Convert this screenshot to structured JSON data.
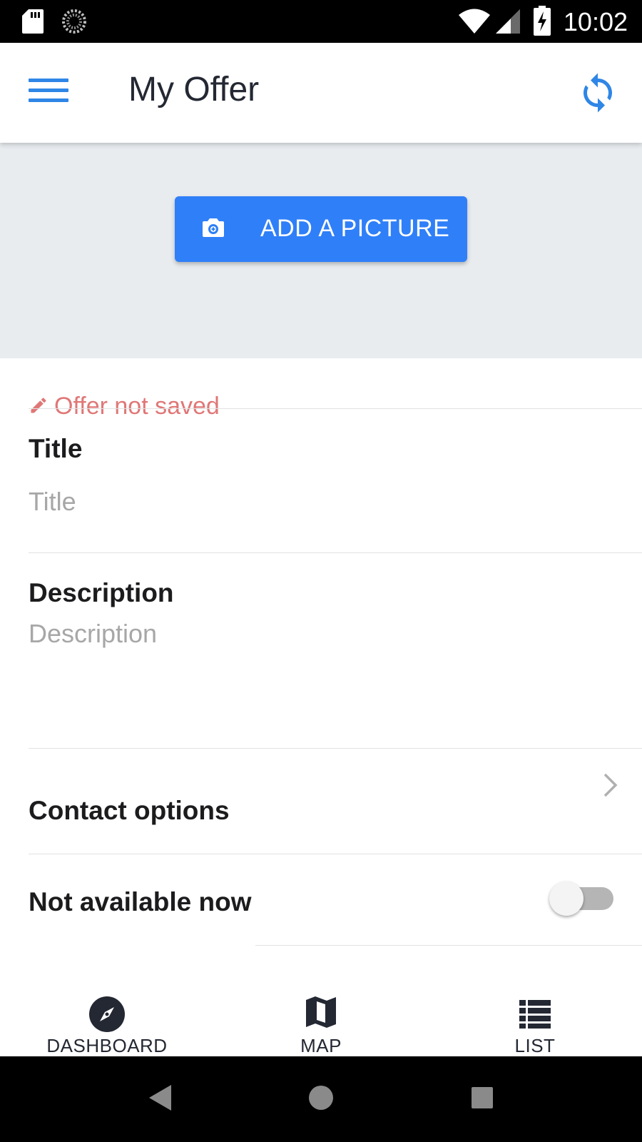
{
  "status_bar": {
    "time": "10:02",
    "icons": [
      "sd-card-icon",
      "loading-icon",
      "wifi-icon",
      "signal-icon",
      "battery-charging-icon"
    ]
  },
  "app_bar": {
    "title": "My Offer",
    "menu_icon": "hamburger-menu-icon",
    "action_icon": "refresh-icon",
    "accent_color": "#2f86e6"
  },
  "photo": {
    "button_label": "ADD A PICTURE",
    "button_icon": "camera-icon",
    "button_color": "#2f7ff8"
  },
  "save_status": {
    "icon": "pencil-icon",
    "text": "Offer not saved",
    "color": "#e07777"
  },
  "form": {
    "title_label": "Title",
    "title_placeholder": "Title",
    "title_value": "",
    "description_label": "Description",
    "description_placeholder": "Description",
    "description_value": ""
  },
  "rows": {
    "contact_options": "Contact options",
    "not_available_now": "Not available now",
    "not_available_value": false
  },
  "tabs": [
    {
      "label": "DASHBOARD",
      "icon": "compass-icon"
    },
    {
      "label": "MAP",
      "icon": "map-icon"
    },
    {
      "label": "LIST",
      "icon": "list-icon"
    }
  ],
  "nav_bar": {
    "icons": [
      "back-icon",
      "home-icon",
      "recents-icon"
    ]
  }
}
